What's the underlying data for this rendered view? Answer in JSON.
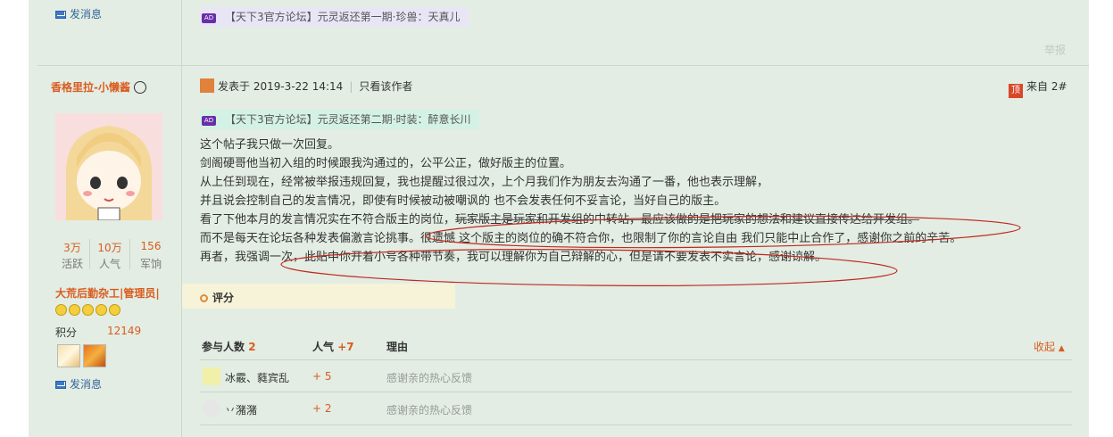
{
  "prev_post": {
    "send_message": "发消息",
    "ad_text": "【天下3官方论坛】元灵返还第一期·珍兽：天真儿",
    "report": "举报"
  },
  "author": {
    "name": "香格里拉-小懒酱",
    "stats": [
      {
        "value": "3万",
        "label": "活跃"
      },
      {
        "value": "10万",
        "label": "人气"
      },
      {
        "value": "156",
        "label": "军饷"
      }
    ],
    "group": "大荒后勤杂工",
    "role": "管理员",
    "points_label": "积分",
    "points_value": "12149",
    "send_message": "发消息",
    "smiley_count": 5
  },
  "post": {
    "posted_at": "发表于 2019-3-22 14:14",
    "only_author": "只看该作者",
    "from": "来自 2#",
    "from_icon": "顶",
    "ad_badge": "AD",
    "ad_text": "【天下3官方论坛】元灵返还第二期·时装：醉意长川",
    "lines": [
      "这个帖子我只做一次回复。",
      "剑阁硬哥他当初入组的时候跟我沟通过的，公平公正，做好版主的位置。",
      "从上任到现在，经常被举报违规回复，我也提醒过很过次，上个月我们作为朋友去沟通了一番，他也表示理解，",
      "并且说会控制自己的发言情况，即使有时候被动被嘲讽的 也不会发表任何不妥言论，当好自己的版主。",
      "看了下他本月的发言情况实在不符合版主的岗位，",
      "玩家版主是玩家和开发组的中转站，最应该做的是把玩家的想法和建议直接传达给开发组。",
      "而不是每天在论坛各种发表偏激言论挑事。",
      "很遗憾 这个版主的岗位的确不符合你，也限制了你的言论自由 我们只能中止合作了，感谢你之前的辛苦。",
      "再者，我强调一次，",
      "此贴中你开着小号各种带节奏，我可以理解你为自己辩解的心，但是请不要发表不实言论，感谢谅解。"
    ]
  },
  "rating": {
    "title": "评分",
    "col_participants": "参与人数",
    "participants": "2",
    "col_popularity": "人气",
    "popularity_total": "+7",
    "col_reason": "理由",
    "collapse": "收起",
    "rows": [
      {
        "user": "冰霰、蕤宾乱",
        "score": "+ 5",
        "reason": "感谢亲的热心反馈"
      },
      {
        "user": "丷潴潴",
        "score": "+ 2",
        "reason": "感谢亲的热心反馈"
      }
    ]
  },
  "annotation_color": "#c0281e"
}
